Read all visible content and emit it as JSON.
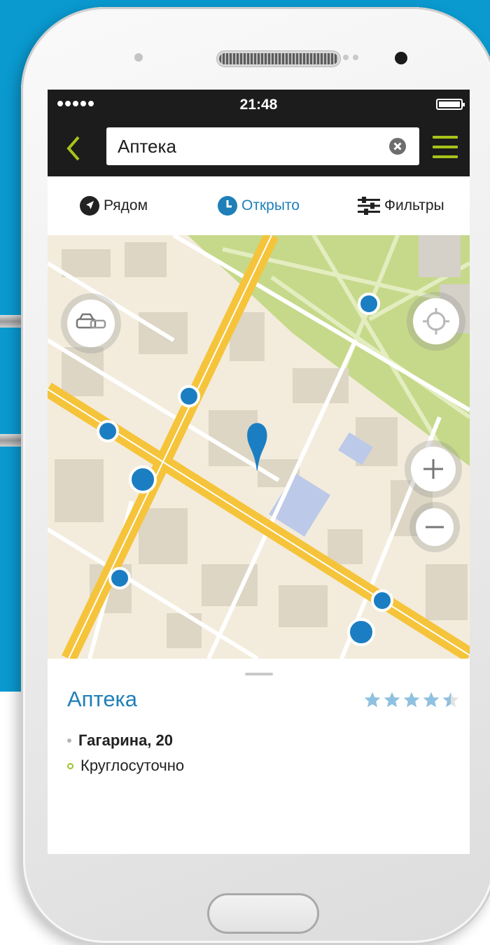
{
  "status_bar": {
    "time": "21:48"
  },
  "search": {
    "value": "Аптека"
  },
  "filters": [
    {
      "label": "Рядом",
      "icon": "navigation-arrow-icon"
    },
    {
      "label": "Открыто",
      "icon": "clock-icon",
      "active": true
    },
    {
      "label": "Фильтры",
      "icon": "filter-sliders-icon"
    }
  ],
  "map_controls": [
    "parking-cars-icon",
    "locate-me-icon",
    "zoom-in-icon",
    "zoom-out-icon"
  ],
  "place": {
    "name": "Аптека",
    "rating": 4.5,
    "rating_max": 5,
    "address": "Гагарина, 20",
    "hours": "Круглосуточно"
  },
  "colors": {
    "background": "#0a9ad0",
    "accent": "#a6c41a",
    "link": "#1f7fb8",
    "marker": "#1c7ec2",
    "road": "#f5c43b",
    "park": "#c6d98a"
  }
}
